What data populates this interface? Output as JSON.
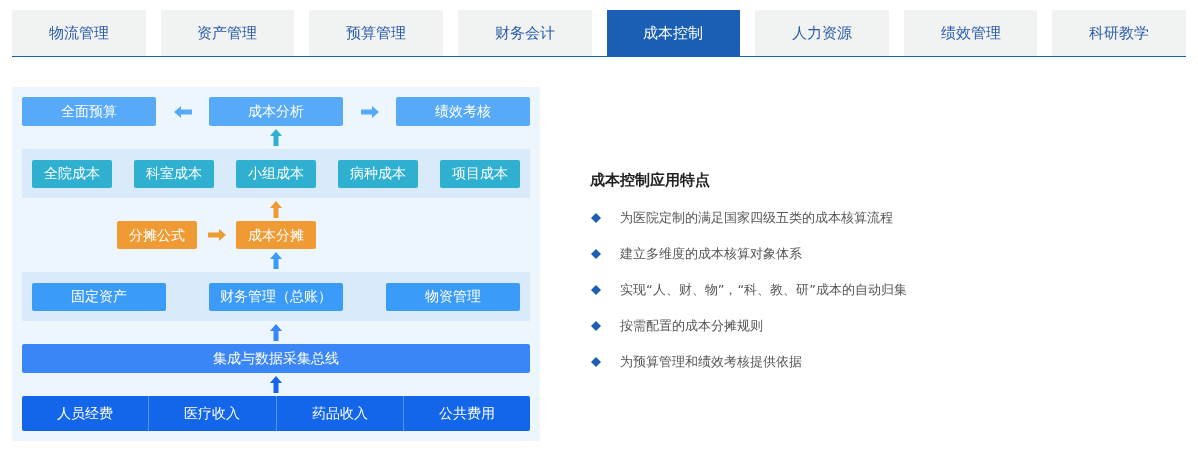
{
  "tabs": [
    {
      "label": "物流管理",
      "selected": false
    },
    {
      "label": "资产管理",
      "selected": false
    },
    {
      "label": "预算管理",
      "selected": false
    },
    {
      "label": "财务会计",
      "selected": false
    },
    {
      "label": "成本控制",
      "selected": true
    },
    {
      "label": "人力资源",
      "selected": false
    },
    {
      "label": "绩效管理",
      "selected": false
    },
    {
      "label": "科研教学",
      "selected": false
    }
  ],
  "diagram": {
    "top": {
      "left": "全面预算",
      "center": "成本分析",
      "right": "绩效考核"
    },
    "cost_objects": [
      "全院成本",
      "科室成本",
      "小组成本",
      "病种成本",
      "项目成本"
    ],
    "allocation": {
      "formula": "分摊公式",
      "result": "成本分摊"
    },
    "ledgers": [
      "固定资产",
      "财务管理（总账）",
      "物资管理"
    ],
    "bus": "集成与数据采集总线",
    "sources": [
      "人员经费",
      "医疗收入",
      "药品收入",
      "公共费用"
    ]
  },
  "features": {
    "title": "成本控制应用特点",
    "items": [
      "为医院定制的满足国家四级五类的成本核算流程",
      "建立多维度的成本核算对象体系",
      "实现“人、财、物”，“科、教、研”成本的自动归集",
      "按需配置的成本分摊规则",
      "为预算管理和绩效考核提供依据"
    ]
  }
}
